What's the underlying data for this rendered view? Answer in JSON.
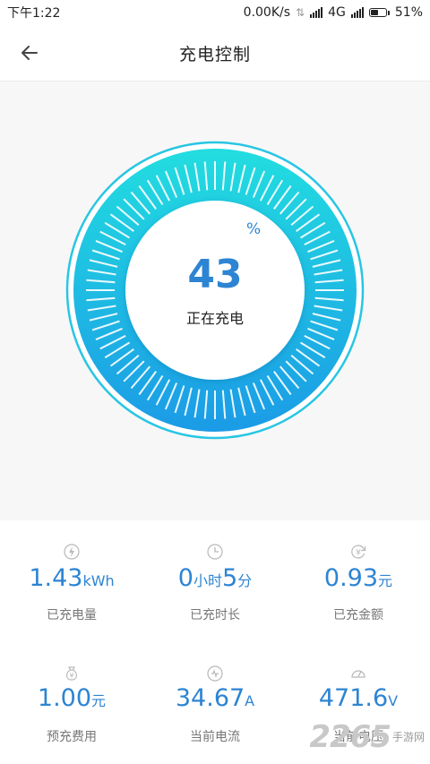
{
  "status_bar": {
    "time": "下午1:22",
    "speed": "0.00K/s",
    "network": "4G",
    "battery": "51%",
    "battery_level": 0.51
  },
  "header": {
    "title": "充电控制",
    "back_icon": "arrow-left-icon"
  },
  "charge": {
    "percent": "43",
    "percent_sign": "%",
    "status": "正在充电",
    "level": 0.43
  },
  "stats": [
    {
      "icon": "lightning-icon",
      "value": "1.43",
      "unit": "kWh",
      "label": "已充电量"
    },
    {
      "icon": "clock-icon",
      "value": "0",
      "unit": "小时",
      "value2": "5",
      "unit2": "分",
      "label": "已充时长"
    },
    {
      "icon": "yuan-refresh-icon",
      "value": "0.93",
      "unit": "元",
      "label": "已充金额"
    },
    {
      "icon": "money-bag-icon",
      "value": "1.00",
      "unit": "元",
      "label": "预充费用"
    },
    {
      "icon": "current-icon",
      "value": "34.67",
      "unit": "A",
      "label": "当前电流"
    },
    {
      "icon": "gauge-icon",
      "value": "471.6",
      "unit": "V",
      "label": "当前电压"
    }
  ],
  "watermark": {
    "number": "2265",
    "text": "手游网"
  },
  "colors": {
    "accent": "#2d84d3",
    "gauge_start": "#22dde0",
    "gauge_end": "#1b9be6"
  }
}
